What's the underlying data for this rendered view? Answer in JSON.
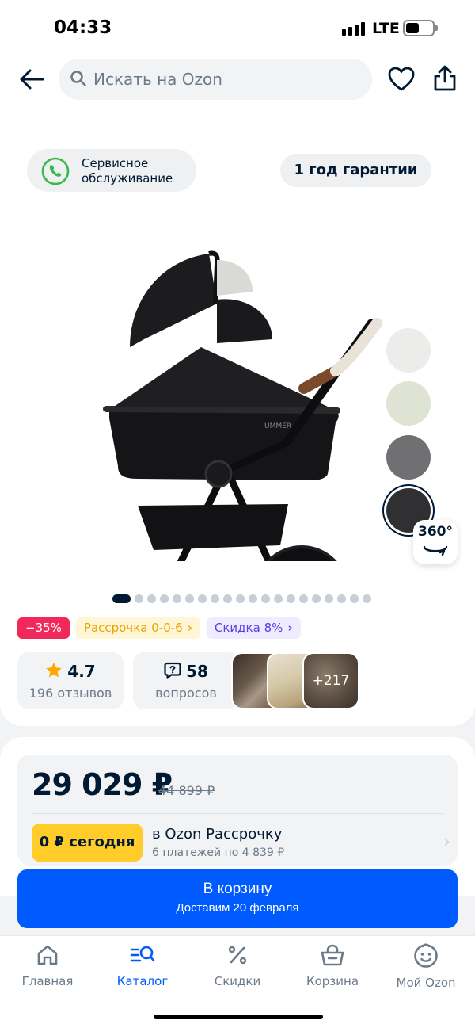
{
  "status_bar": {
    "time": "04:33",
    "network": "LTE"
  },
  "header": {
    "search_placeholder": "Искать на Ozon",
    "icons": [
      "back-arrow-icon",
      "search-icon",
      "heart-icon",
      "share-icon"
    ]
  },
  "product": {
    "service_badge": {
      "line1": "Сервисное",
      "line2": "обслуживание"
    },
    "warranty": "1 год гарантии",
    "colors": [
      "#ececea",
      "#dfe3d4",
      "#707072",
      "#303033"
    ],
    "selected_color_index": 3,
    "view_360": "360°",
    "gallery": {
      "total_dots": 20,
      "active_index": 0
    },
    "badges": [
      {
        "text": "−35%"
      },
      {
        "text": "Рассрочка 0-0-6",
        "chevron": "›"
      },
      {
        "text": "Скидка 8%",
        "chevron": "›"
      }
    ],
    "rating": {
      "value": "4.7",
      "reviews": "196 отзывов"
    },
    "questions": {
      "value": "58",
      "label": "вопросов"
    },
    "photos_more": "+217"
  },
  "price": {
    "current": "29 029 ₽",
    "old": "44 899 ₽",
    "today_label": "0 ₽ сегодня",
    "installment_title": "в Ozon Рассрочку",
    "installment_sub": "6 платежей по 4 839 ₽"
  },
  "cart_button": {
    "label": "В корзину",
    "delivery": "Доставим 20 февраля"
  },
  "nav": [
    {
      "label": "Главная",
      "icon": "home-icon"
    },
    {
      "label": "Каталог",
      "icon": "catalog-icon",
      "active": true
    },
    {
      "label": "Скидки",
      "icon": "percent-icon"
    },
    {
      "label": "Корзина",
      "icon": "basket-icon"
    },
    {
      "label": "Мой Ozon",
      "icon": "profile-icon"
    }
  ],
  "colors": {
    "brand": "#005bff",
    "text": "#001a34",
    "secondary": "#6b7a8a",
    "sale": "#f0295a",
    "installment": "#ffcc29"
  }
}
